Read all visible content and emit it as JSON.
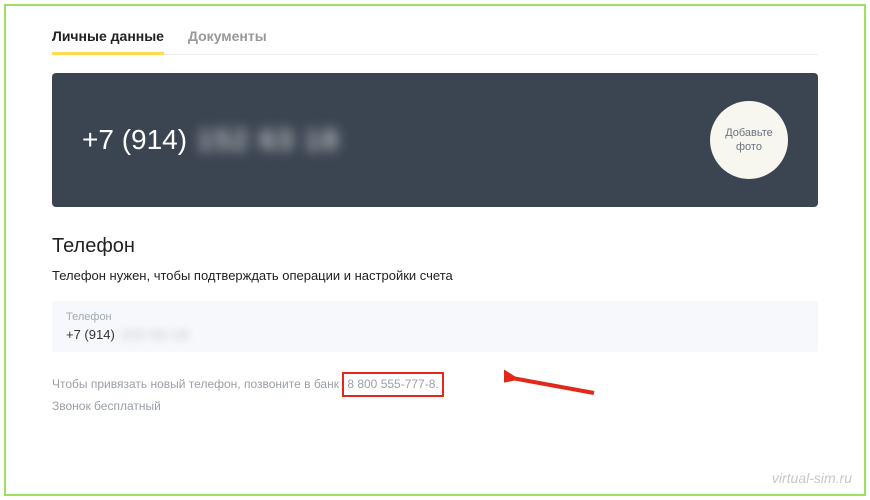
{
  "tabs": {
    "personal": "Личные данные",
    "documents": "Документы"
  },
  "banner": {
    "phone_prefix": "+7 (914)",
    "phone_hidden": "152 63 18",
    "avatar_line1": "Добавьте",
    "avatar_line2": "фото"
  },
  "phone_section": {
    "title": "Телефон",
    "desc": "Телефон нужен, чтобы подтверждать операции и настройки счета",
    "field_label": "Телефон",
    "field_value_prefix": "+7 (914)",
    "field_value_hidden": "152-63-18"
  },
  "note": {
    "part1": "Чтобы привязать новый телефон, позвоните в банк",
    "highlight": "8 800 555-777-8.",
    "line2": "Звонок бесплатный"
  },
  "watermark": "virtual-sim.ru"
}
